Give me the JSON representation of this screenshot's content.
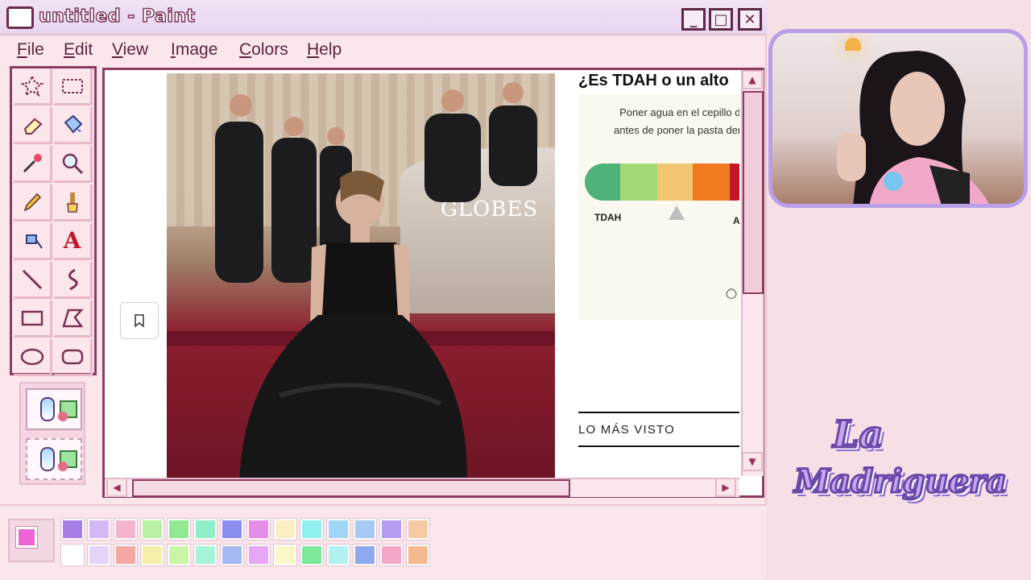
{
  "window": {
    "title": "untitled - Paint",
    "buttons": {
      "minimize": "_",
      "maximize": "□",
      "close": "✕"
    }
  },
  "menu": [
    "File",
    "Edit",
    "View",
    "Image",
    "Colors",
    "Help"
  ],
  "toolbox": {
    "tools": [
      "free-select",
      "rect-select",
      "eraser",
      "fill",
      "color-picker",
      "magnifier",
      "pencil",
      "brush",
      "airbrush",
      "text",
      "line",
      "curve",
      "rectangle",
      "polygon",
      "ellipse",
      "rounded-rectangle"
    ]
  },
  "article": {
    "title": "¿Es TDAH o un alto",
    "quiz_line1": "Poner agua en el cepillo de dien",
    "quiz_line2": "antes de poner la pasta denta",
    "scale_left_label": "TDAH",
    "scale_right_label": "A",
    "scale_colors": [
      "#4db37a",
      "#a3d977",
      "#f2c572",
      "#f07a1e",
      "#c4162a"
    ],
    "section_title": "LO MÁS VISTO"
  },
  "photo": {
    "banner_text": "GLOBES"
  },
  "palette": {
    "current_fg": "#ee64d6",
    "current_bg": "#ffffff",
    "row1": [
      "#a77ee8",
      "#d2b9f5",
      "#f4b4cd",
      "#b9f0a4",
      "#93e893",
      "#8ff0c8",
      "#8a8cf0",
      "#e58ee8",
      "#fbeec3",
      "#8ff0ec",
      "#9fd6f5",
      "#a7c9f5",
      "#b59cf0",
      "#f5c9a3"
    ],
    "row2": [
      "#ffffff",
      "#e7d3f5",
      "#f5a7a3",
      "#f5f0a7",
      "#c9f5a7",
      "#a7f5d6",
      "#a7b9f5",
      "#e7a7f5",
      "#fbf7c9",
      "#7de89a",
      "#b3f0f0",
      "#8ea9f0",
      "#f5a7c9",
      "#f5b98f"
    ]
  },
  "logo": {
    "line1": "La",
    "line2": "Madriguera"
  },
  "colors": {
    "window_border": "#8c3c62",
    "frame_purple": "#b99ee8",
    "background": "#f7dfe6"
  }
}
